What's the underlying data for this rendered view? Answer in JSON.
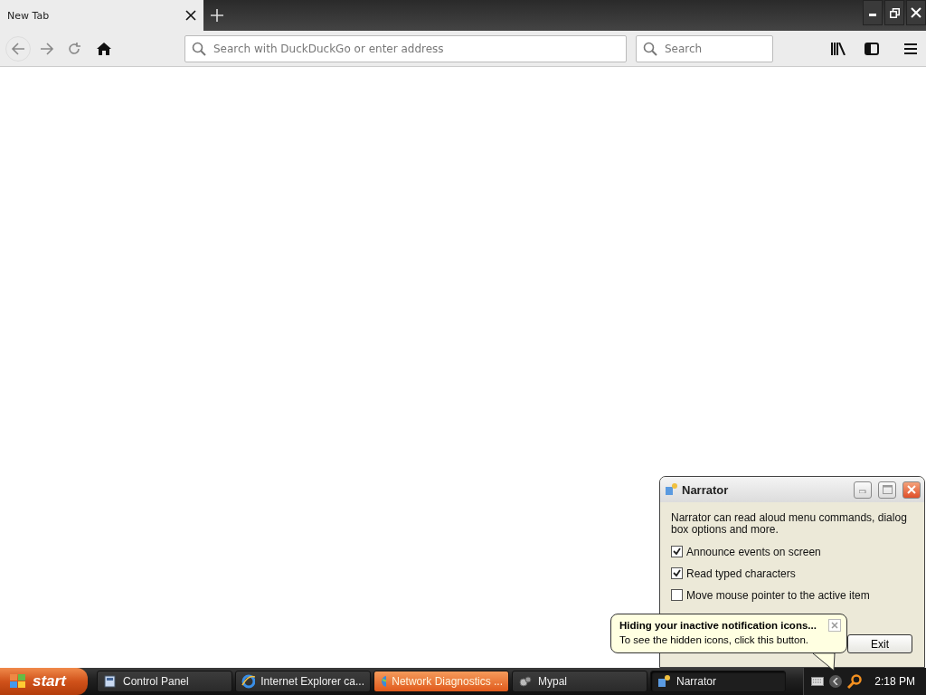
{
  "browser": {
    "tabs": [
      {
        "label": "New Tab",
        "selected": true
      }
    ],
    "address": {
      "placeholder": "Search with DuckDuckGo or enter address"
    },
    "search": {
      "placeholder": "Search"
    }
  },
  "narrator": {
    "title": "Narrator",
    "description": "Narrator can read aloud menu commands, dialog box options and more.",
    "options": [
      {
        "label": "Announce events on screen",
        "checked": true
      },
      {
        "label": "Read typed characters",
        "checked": true
      },
      {
        "label": "Move mouse pointer to the active item",
        "checked": false
      }
    ],
    "buttons": [
      "Exit"
    ]
  },
  "balloon": {
    "title": "Hiding your inactive notification icons...",
    "text": "To see the hidden icons, click this button."
  },
  "taskbar": {
    "start": "start",
    "items": [
      {
        "label": "Control Panel",
        "selected": false,
        "flashing": false
      },
      {
        "label": "Internet Explorer ca...",
        "selected": false,
        "flashing": false
      },
      {
        "label": "Network Diagnostics ...",
        "selected": false,
        "flashing": true
      },
      {
        "label": "Mypal",
        "selected": false,
        "flashing": false
      },
      {
        "label": "Narrator",
        "selected": true,
        "flashing": false
      }
    ],
    "clock": "2:18 PM"
  }
}
